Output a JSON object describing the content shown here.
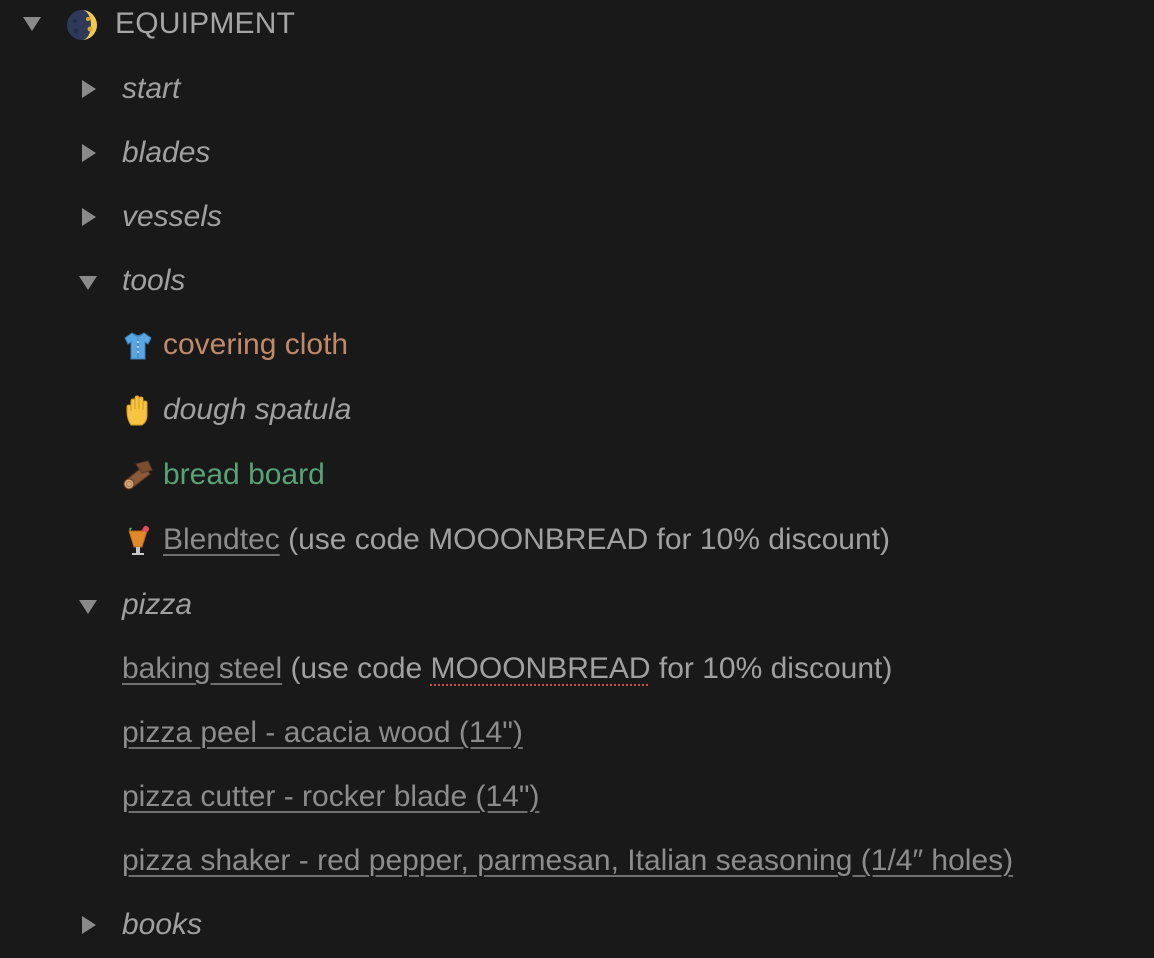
{
  "header": {
    "title": "EQUIPMENT",
    "icon": "moon-icon"
  },
  "sections": {
    "start": "start",
    "blades": "blades",
    "vessels": "vessels",
    "tools": "tools",
    "pizza": "pizza",
    "books": "books"
  },
  "tools": {
    "covering_cloth": "covering cloth",
    "dough_spatula": "dough spatula",
    "bread_board": "bread board",
    "blendtec_link": "Blendtec",
    "blendtec_note": " (use code MOOONBREAD for 10% discount)"
  },
  "pizza": {
    "baking_steel_link": "baking steel",
    "baking_steel_note_a": " (use code ",
    "baking_steel_code": "MOOONBREAD",
    "baking_steel_note_b": " for 10% discount)",
    "peel": "pizza peel - acacia wood (14\")",
    "cutter": "pizza cutter - rocker blade (14\")",
    "shaker": "pizza shaker - red pepper, parmesan, Italian seasoning (1/4″ holes)"
  },
  "colors": {
    "background": "#191919",
    "text": "#a0a0a0",
    "orange": "#c0896a",
    "green": "#58a275",
    "link": "#8c8c8c"
  }
}
